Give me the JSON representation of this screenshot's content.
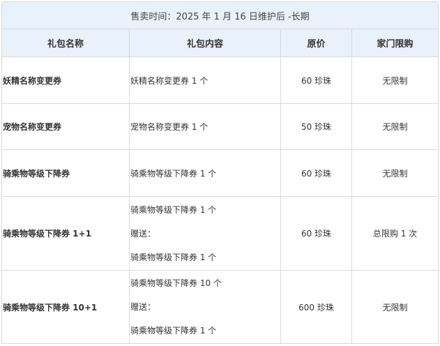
{
  "banner": "售卖时间：2025 年 1 月 16 日维护后 -长期",
  "headers": [
    "礼包名称",
    "礼包内容",
    "原价",
    "家门限购"
  ],
  "rows": [
    {
      "name": "妖精名称变更券",
      "content": [
        "妖精名称变更券 1 个"
      ],
      "price": "60 珍珠",
      "limit": "无限制"
    },
    {
      "name": "宠物名称变更券",
      "content": [
        "宠物名称变更券 1 个"
      ],
      "price": "50 珍珠",
      "limit": "无限制"
    },
    {
      "name": "骑乘物等级下降券",
      "content": [
        "骑乘物等级下降券 1 个"
      ],
      "price": "60 珍珠",
      "limit": "无限制"
    },
    {
      "name": "骑乘物等级下降券 1+1",
      "content": [
        "骑乘物等级下降券 1 个",
        "赠送：",
        "骑乘物等级下降券 1 个"
      ],
      "price": "60 珍珠",
      "limit": "总限购 1 次"
    },
    {
      "name": "骑乘物等级下降券 10+1",
      "content": [
        "骑乘物等级下降券 10 个",
        "赠送：",
        "骑乘物等级下降券 1 个"
      ],
      "price": "600 珍珠",
      "limit": "无限制"
    }
  ]
}
